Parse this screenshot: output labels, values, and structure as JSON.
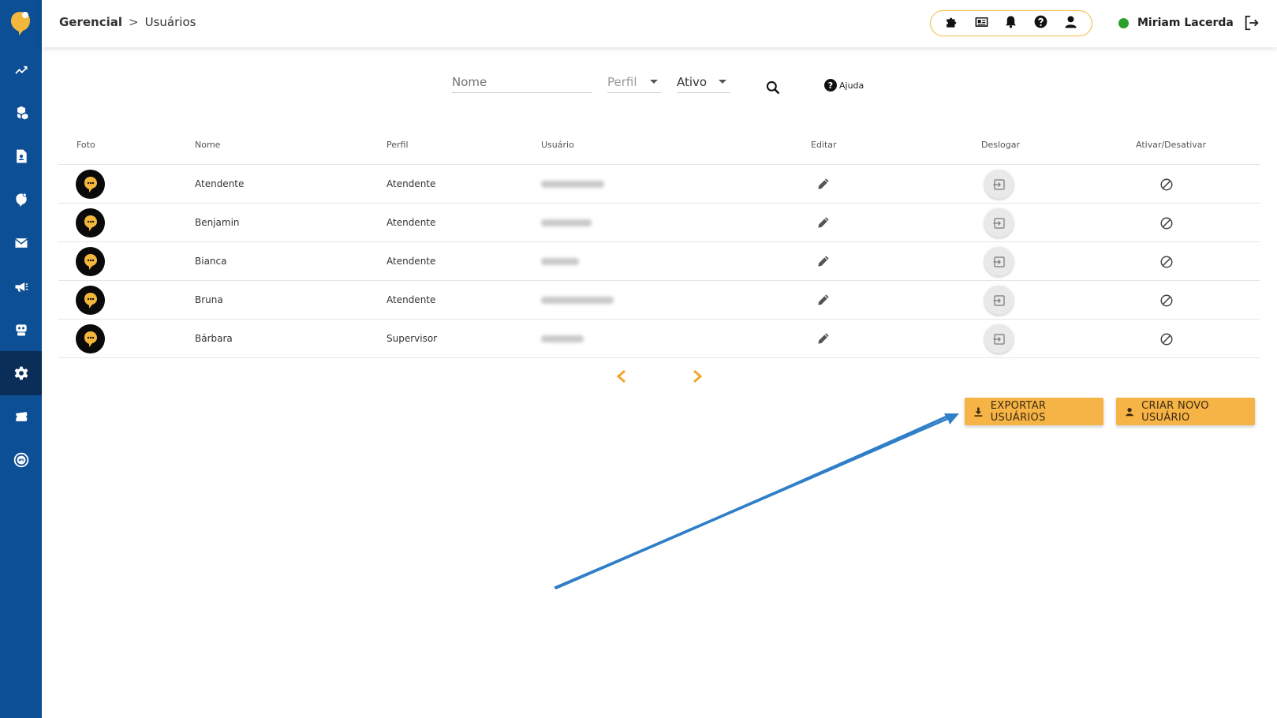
{
  "sidebar": {
    "items": [
      {
        "icon": "chart-trend-icon"
      },
      {
        "icon": "cubes-icon"
      },
      {
        "icon": "contact-card-icon"
      },
      {
        "icon": "chat-bubble-icon"
      },
      {
        "icon": "envelope-icon"
      },
      {
        "icon": "megaphone-icon"
      },
      {
        "icon": "robot-icon"
      },
      {
        "icon": "gear-icon",
        "active": true
      },
      {
        "icon": "ticket-icon"
      },
      {
        "icon": "nps-icon"
      }
    ],
    "color": "#0d4f95",
    "active_color": "#0a2e57"
  },
  "header": {
    "breadcrumb_root": "Gerencial",
    "breadcrumb_current": "Usuários",
    "user_name": "Miriam Lacerda",
    "status_color": "#2ca02c"
  },
  "filters": {
    "name_placeholder": "Nome",
    "profile_placeholder": "Perfil",
    "status_value": "Ativo",
    "help_label": "Ajuda"
  },
  "table": {
    "headers": {
      "foto": "Foto",
      "nome": "Nome",
      "perfil": "Perfil",
      "usuario": "Usuário",
      "editar": "Editar",
      "deslogar": "Deslogar",
      "ativar": "Ativar/Desativar"
    },
    "rows": [
      {
        "nome": "Atendente",
        "perfil": "Atendente"
      },
      {
        "nome": "Benjamin",
        "perfil": "Atendente"
      },
      {
        "nome": "Bianca",
        "perfil": "Atendente"
      },
      {
        "nome": "Bruna",
        "perfil": "Atendente"
      },
      {
        "nome": "Bárbara",
        "perfil": "Supervisor"
      }
    ]
  },
  "actions": {
    "export_label": "EXPORTAR USUÁRIOS",
    "create_label": "CRIAR NOVO USUÁRIO",
    "button_color": "#f7b446"
  },
  "accent_color": "#f4b73d",
  "annotation_color": "#2f7fc8"
}
